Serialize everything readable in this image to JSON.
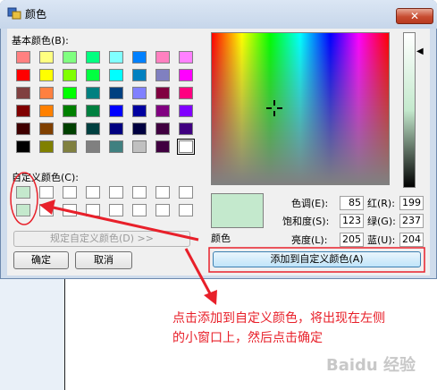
{
  "window": {
    "title": "颜色",
    "close_label": "✕"
  },
  "basic_colors": {
    "label": "基本颜色(B):",
    "swatches": [
      "#ff8080",
      "#ffff80",
      "#80ff80",
      "#00ff80",
      "#80ffff",
      "#0080ff",
      "#ff80c0",
      "#ff80ff",
      "#ff0000",
      "#ffff00",
      "#80ff00",
      "#00ff40",
      "#00ffff",
      "#0080c0",
      "#8080c0",
      "#ff00ff",
      "#804040",
      "#ff8040",
      "#00ff00",
      "#008080",
      "#004080",
      "#8080ff",
      "#800040",
      "#ff0080",
      "#800000",
      "#ff8000",
      "#008000",
      "#008040",
      "#0000ff",
      "#0000a0",
      "#800080",
      "#8000ff",
      "#400000",
      "#804000",
      "#004000",
      "#004040",
      "#000080",
      "#000040",
      "#400040",
      "#400080",
      "#000000",
      "#808000",
      "#808040",
      "#808080",
      "#408080",
      "#c0c0c0",
      "#400040",
      "#ffffff"
    ],
    "selected_index": 47
  },
  "custom_colors": {
    "label": "自定义颜色(C):",
    "swatches": [
      "#c4e9cd",
      "#ffffff",
      "#ffffff",
      "#ffffff",
      "#ffffff",
      "#ffffff",
      "#ffffff",
      "#ffffff",
      "#c4e9cd",
      "#ffffff",
      "#ffffff",
      "#ffffff",
      "#ffffff",
      "#ffffff",
      "#ffffff",
      "#ffffff"
    ]
  },
  "buttons": {
    "define_custom": "规定自定义颜色(D) >>",
    "ok": "确定",
    "cancel": "取消",
    "add_custom": "添加到自定义颜色(A)"
  },
  "preview": {
    "label": "颜色",
    "color": "#c4e9cd"
  },
  "values": {
    "hue_label": "色调(E):",
    "hue": "85",
    "sat_label": "饱和度(S):",
    "sat": "123",
    "lum_label": "亮度(L):",
    "lum": "205",
    "red_label": "红(R):",
    "red": "199",
    "green_label": "绿(G):",
    "green": "237",
    "blue_label": "蓝(U):",
    "blue": "204"
  },
  "annotation": {
    "line1": "点击添加到自定义颜色，将出现在左侧",
    "line2": "的小窗口上，然后点击确定",
    "color": "#e8202a"
  },
  "watermark": "Baidu 经验",
  "lum_arrow": "◀"
}
